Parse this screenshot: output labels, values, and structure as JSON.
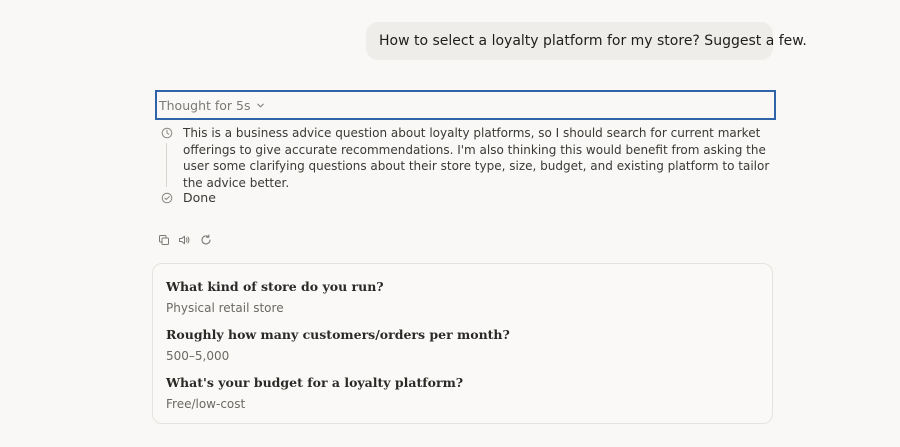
{
  "user_message": {
    "text": "How to select a loyalty platform for my store? Suggest a few."
  },
  "thinking": {
    "toggle_label": "Thought for 5s",
    "thought_text": "This is a business advice question about loyalty platforms, so I should search for current market offerings to give accurate recommendations. I'm also thinking this would benefit from asking the user some clarifying questions about their store type, size, budget, and existing platform to tailor the advice better.",
    "done_label": "Done",
    "icons": [
      "clock-icon",
      "check-circle-icon",
      "chevron-down-icon"
    ]
  },
  "message_actions": {
    "icons": [
      "copy-icon",
      "speaker-icon",
      "retry-icon"
    ]
  },
  "answers": {
    "items": [
      {
        "question": "What kind of store do you run?",
        "answer": "Physical retail store"
      },
      {
        "question": "Roughly how many customers/orders per month?",
        "answer": "500–5,000"
      },
      {
        "question": "What's your budget for a loyalty platform?",
        "answer": "Free/low-cost"
      }
    ]
  }
}
